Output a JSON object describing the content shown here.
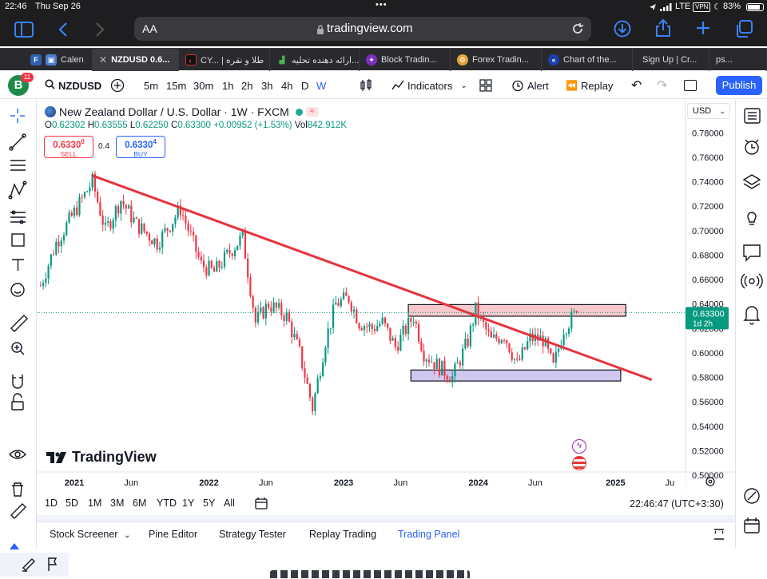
{
  "status": {
    "time": "22:46",
    "date": "Thu Sep 26",
    "network": "LTE",
    "vpn": "VPN",
    "battery": "83%"
  },
  "browser": {
    "aa": "AA",
    "url": "tradingview.com"
  },
  "tabs": [
    {
      "label": "Calen",
      "icon": "fx-icon"
    },
    {
      "label": "NZDUSD 0.6...",
      "icon": "close-icon",
      "active": true
    },
    {
      "label": "CY... | طلا و نقره",
      "icon": "cy-icon"
    },
    {
      "label": "ارائه دهنده تحلیه...",
      "icon": "chart-icon"
    },
    {
      "label": "Block Tradin...",
      "icon": "block-icon"
    },
    {
      "label": "Forex Tradin...",
      "icon": "forex-icon"
    },
    {
      "label": "Chart of the...",
      "icon": "chart-of-icon"
    },
    {
      "label": "Sign Up | Cr...",
      "icon": "signup-icon"
    },
    {
      "label": "ps...",
      "icon": ""
    }
  ],
  "toolbar": {
    "avatar": "B",
    "avatar_badge": "11",
    "symbol": "NZDUSD",
    "intervals": [
      "5m",
      "15m",
      "30m",
      "1h",
      "2h",
      "3h",
      "4h",
      "D",
      "W"
    ],
    "active_interval": "W",
    "indicators": "Indicators",
    "alert": "Alert",
    "replay": "Replay",
    "publish": "Publish"
  },
  "legend": {
    "title": "New Zealand Dollar / U.S. Dollar · 1W · FXCM",
    "o_label": "O",
    "o": "0.62302",
    "h_label": "H",
    "h": "0.63555",
    "l_label": "L",
    "l": "0.62250",
    "c_label": "C",
    "c": "0.63300",
    "change": "+0.00952 (+1.53%)",
    "vol_label": "Vol",
    "vol": "842.912K",
    "sell_price": "0.6330",
    "sell_sup": "0",
    "sell_label": "SELL",
    "spread": "0.4",
    "buy_price": "0.6330",
    "buy_sup": "4",
    "buy_label": "BUY"
  },
  "price_axis": {
    "currency": "USD",
    "labels": [
      "0.78000",
      "0.76000",
      "0.74000",
      "0.72000",
      "0.70000",
      "0.68000",
      "0.66000",
      "0.64000",
      "0.62000",
      "0.60000",
      "0.58000",
      "0.56000",
      "0.54000",
      "0.52000",
      "0.50000"
    ],
    "current_price": "0.63300",
    "countdown": "1d 2h"
  },
  "time_axis": {
    "labels": [
      "2021",
      "Jun",
      "2022",
      "Jun",
      "2023",
      "Jun",
      "2024",
      "Jun",
      "2025",
      "Ju"
    ]
  },
  "watermark": "TradingView",
  "ranges": [
    "1D",
    "5D",
    "1M",
    "3M",
    "6M",
    "YTD",
    "1Y",
    "5Y",
    "All"
  ],
  "clock": "22:46:47 (UTC+3:30)",
  "bottom_tabs": [
    "Stock Screener",
    "Pine Editor",
    "Strategy Tester",
    "Replay Trading",
    "Trading Panel"
  ],
  "colors": {
    "up": "#089981",
    "down": "#f23645",
    "trendline": "#e5343d",
    "resistance": "#f8c9cc",
    "support": "#cfc7ee",
    "accent": "#2962ff"
  },
  "chart_data": {
    "type": "candlestick",
    "interval": "1W",
    "ylim": [
      0.5,
      0.79
    ],
    "y_axis_ticks": [
      0.5,
      0.52,
      0.54,
      0.56,
      0.58,
      0.6,
      0.62,
      0.64,
      0.66,
      0.68,
      0.7,
      0.72,
      0.74,
      0.76,
      0.78
    ],
    "x_range": [
      "2020-10",
      "2025-07"
    ],
    "last_close": 0.633,
    "price_path": [
      [
        "2020-10-05",
        0.655
      ],
      [
        "2020-11-16",
        0.69
      ],
      [
        "2021-01-04",
        0.715
      ],
      [
        "2021-02-22",
        0.74
      ],
      [
        "2021-03-29",
        0.7
      ],
      [
        "2021-05-10",
        0.725
      ],
      [
        "2021-06-21",
        0.705
      ],
      [
        "2021-08-16",
        0.69
      ],
      [
        "2021-09-20",
        0.705
      ],
      [
        "2021-10-18",
        0.718
      ],
      [
        "2021-12-13",
        0.672
      ],
      [
        "2022-01-17",
        0.666
      ],
      [
        "2022-03-07",
        0.685
      ],
      [
        "2022-04-04",
        0.695
      ],
      [
        "2022-05-09",
        0.625
      ],
      [
        "2022-06-13",
        0.64
      ],
      [
        "2022-08-01",
        0.63
      ],
      [
        "2022-09-05",
        0.6
      ],
      [
        "2022-10-10",
        0.555
      ],
      [
        "2022-11-14",
        0.61
      ],
      [
        "2022-12-12",
        0.64
      ],
      [
        "2023-01-16",
        0.645
      ],
      [
        "2023-02-13",
        0.625
      ],
      [
        "2023-03-20",
        0.62
      ],
      [
        "2023-04-17",
        0.625
      ],
      [
        "2023-05-22",
        0.605
      ],
      [
        "2023-07-10",
        0.63
      ],
      [
        "2023-08-07",
        0.6
      ],
      [
        "2023-09-11",
        0.59
      ],
      [
        "2023-10-23",
        0.58
      ],
      [
        "2023-12-04",
        0.61
      ],
      [
        "2023-12-25",
        0.635
      ],
      [
        "2024-02-05",
        0.61
      ],
      [
        "2024-03-11",
        0.615
      ],
      [
        "2024-04-15",
        0.59
      ],
      [
        "2024-05-20",
        0.612
      ],
      [
        "2024-06-24",
        0.611
      ],
      [
        "2024-07-22",
        0.588
      ],
      [
        "2024-08-19",
        0.62
      ],
      [
        "2024-09-23",
        0.633
      ]
    ],
    "trendline": {
      "from": [
        "2021-02-22",
        0.745
      ],
      "to": [
        "2025-04-14",
        0.578
      ]
    },
    "resistance_zone": {
      "from": "2023-06-26",
      "to": "2025-02-03",
      "top": 0.6395,
      "bottom": 0.63
    },
    "support_zone": {
      "from": "2023-07-03",
      "to": "2025-01-20",
      "top": 0.586,
      "bottom": 0.577
    }
  }
}
